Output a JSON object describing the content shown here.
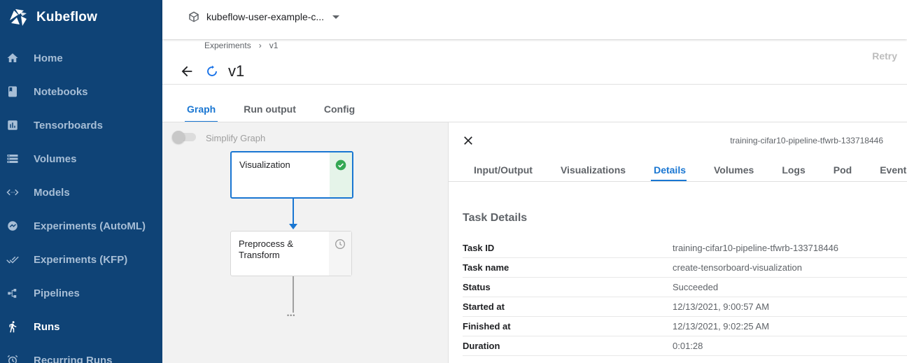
{
  "app": {
    "name": "Kubeflow"
  },
  "sidebar": {
    "items": [
      {
        "label": "Home",
        "icon": "home-icon"
      },
      {
        "label": "Notebooks",
        "icon": "notebook-icon"
      },
      {
        "label": "Tensorboards",
        "icon": "chart-icon"
      },
      {
        "label": "Volumes",
        "icon": "storage-icon"
      },
      {
        "label": "Models",
        "icon": "code-arrows-icon"
      },
      {
        "label": "Experiments (AutoML)",
        "icon": "tune-icon"
      },
      {
        "label": "Experiments (KFP)",
        "icon": "done-all-icon"
      },
      {
        "label": "Pipelines",
        "icon": "pipeline-icon"
      },
      {
        "label": "Runs",
        "icon": "run-icon",
        "active": true
      },
      {
        "label": "Recurring Runs",
        "icon": "alarm-icon"
      }
    ]
  },
  "topbar": {
    "namespace": "kubeflow-user-example-c..."
  },
  "header": {
    "breadcrumb": [
      "Experiments",
      "v1"
    ],
    "breadcrumb_separator": "›",
    "title": "v1",
    "retry_label": "Retry"
  },
  "main_tabs": [
    "Graph",
    "Run output",
    "Config"
  ],
  "graph": {
    "simplify_label": "Simplify Graph",
    "simplify_enabled": false,
    "nodes": [
      {
        "label": "Visualization",
        "status": "succeeded",
        "selected": true
      },
      {
        "label": "Preprocess & Transform",
        "status": "pending"
      }
    ],
    "more_indicator": "•••"
  },
  "panel": {
    "run_id": "training-cifar10-pipeline-tfwrb-133718446",
    "tabs": [
      "Input/Output",
      "Visualizations",
      "Details",
      "Volumes",
      "Logs",
      "Pod",
      "Events"
    ],
    "active_tab": "Details",
    "section_title": "Task Details",
    "details": [
      {
        "key": "Task ID",
        "value": "training-cifar10-pipeline-tfwrb-133718446"
      },
      {
        "key": "Task name",
        "value": "create-tensorboard-visualization"
      },
      {
        "key": "Status",
        "value": "Succeeded"
      },
      {
        "key": "Started at",
        "value": "12/13/2021, 9:00:57 AM"
      },
      {
        "key": "Finished at",
        "value": "12/13/2021, 9:02:25 AM"
      },
      {
        "key": "Duration",
        "value": "0:01:28"
      }
    ]
  },
  "colors": {
    "sidebar_bg": "#0f4376",
    "accent": "#1976d2",
    "success": "#34a853"
  }
}
